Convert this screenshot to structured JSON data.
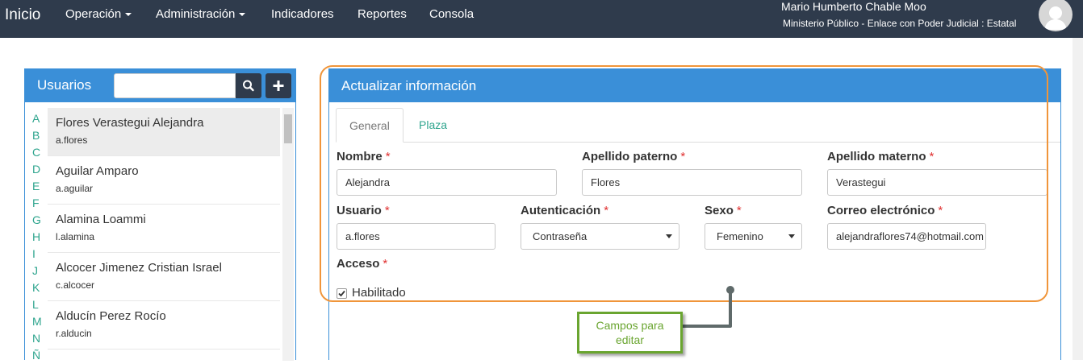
{
  "navbar": {
    "brand": "Inicio",
    "items": [
      {
        "label": "Operación",
        "dropdown": true
      },
      {
        "label": "Administración",
        "dropdown": true
      },
      {
        "label": "Indicadores",
        "dropdown": false
      },
      {
        "label": "Reportes",
        "dropdown": false
      },
      {
        "label": "Consola",
        "dropdown": false
      }
    ],
    "user_name": "Mario Humberto Chable Moo",
    "user_role": "Ministerio Público - Enlace con Poder Judicial : Estatal"
  },
  "users_panel": {
    "title": "Usuarios",
    "search_value": "",
    "letters": [
      "A",
      "B",
      "C",
      "D",
      "E",
      "F",
      "G",
      "H",
      "I",
      "J",
      "K",
      "L",
      "M",
      "N",
      "Ñ"
    ],
    "users": [
      {
        "name": "Flores Verastegui Alejandra",
        "login": "a.flores",
        "active": true
      },
      {
        "name": "Aguilar Amparo",
        "login": "a.aguilar",
        "active": false
      },
      {
        "name": "Alamina Loammi",
        "login": "l.alamina",
        "active": false
      },
      {
        "name": "Alcocer Jimenez Cristian Israel",
        "login": "c.alcocer",
        "active": false
      },
      {
        "name": "Alducín Perez Rocío",
        "login": "r.alducin",
        "active": false
      }
    ]
  },
  "form": {
    "title": "Actualizar información",
    "tabs": [
      {
        "label": "General",
        "active": true
      },
      {
        "label": "Plaza",
        "active": false
      }
    ],
    "required_mark": "*",
    "fields": {
      "nombre": {
        "label": "Nombre",
        "value": "Alejandra"
      },
      "apellido_paterno": {
        "label": "Apellido paterno",
        "value": "Flores"
      },
      "apellido_materno": {
        "label": "Apellido materno",
        "value": "Verastegui"
      },
      "usuario": {
        "label": "Usuario",
        "value": "a.flores"
      },
      "autenticacion": {
        "label": "Autenticación",
        "value": "Contraseña"
      },
      "sexo": {
        "label": "Sexo",
        "value": "Femenino"
      },
      "correo": {
        "label": "Correo electrónico",
        "value": "alejandraflores74@hotmail.com"
      },
      "acceso": {
        "label": "Acceso",
        "checkbox_label": "Habilitado",
        "checked": true
      }
    }
  },
  "annotation": {
    "callout_text": "Campos para editar",
    "frame_color": "#f0953a",
    "callout_color": "#6aa530"
  },
  "colors": {
    "navbar": "#2f3b4c",
    "panel_header": "#3a8fd8",
    "link_green": "#2fa58e",
    "required": "#e03030"
  }
}
